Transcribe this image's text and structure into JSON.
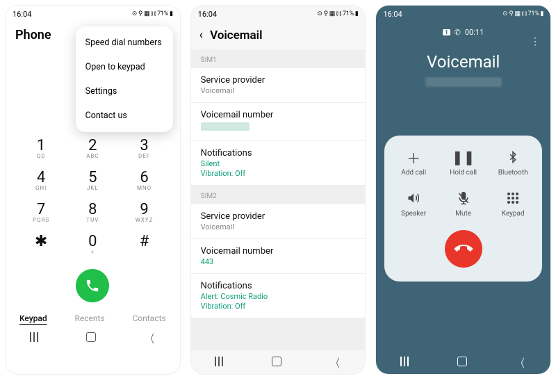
{
  "status": {
    "time": "16:04",
    "icons": "⟟ ✉ ⋯",
    "right": "⊙ ⚲ ▦ ⫾ ⫾ 71% ▮"
  },
  "p1": {
    "title": "Phone",
    "menu": [
      "Speed dial numbers",
      "Open to keypad",
      "Settings",
      "Contact us"
    ],
    "keys": [
      {
        "n": "1",
        "l": "QD"
      },
      {
        "n": "2",
        "l": "ABC"
      },
      {
        "n": "3",
        "l": "DEF"
      },
      {
        "n": "4",
        "l": "GHI"
      },
      {
        "n": "5",
        "l": "JKL"
      },
      {
        "n": "6",
        "l": "MNO"
      },
      {
        "n": "7",
        "l": "PQRS"
      },
      {
        "n": "8",
        "l": "TUV"
      },
      {
        "n": "9",
        "l": "WXYZ"
      },
      {
        "n": "✱",
        "l": ""
      },
      {
        "n": "0",
        "l": "+"
      },
      {
        "n": "#",
        "l": ""
      }
    ],
    "tabs": {
      "keypad": "Keypad",
      "recents": "Recents",
      "contacts": "Contacts"
    }
  },
  "p2": {
    "title": "Voicemail",
    "sim1_lbl": "SIM1",
    "sim2_lbl": "SIM2",
    "sp_t": "Service provider",
    "sp_s": "Voicemail",
    "vn_t": "Voicemail number",
    "nt_t": "Notifications",
    "nt1_a": "Silent",
    "nt_v": "Vibration: Off",
    "vn2_v": "443",
    "nt2_a": "Alert: Cosmic Radio"
  },
  "p3": {
    "sim": "1",
    "timer": "00:11",
    "title": "Voicemail",
    "btns": {
      "add": "Add call",
      "hold": "Hold call",
      "bt": "Bluetooth",
      "spk": "Speaker",
      "mute": "Mute",
      "kp": "Keypad"
    }
  }
}
